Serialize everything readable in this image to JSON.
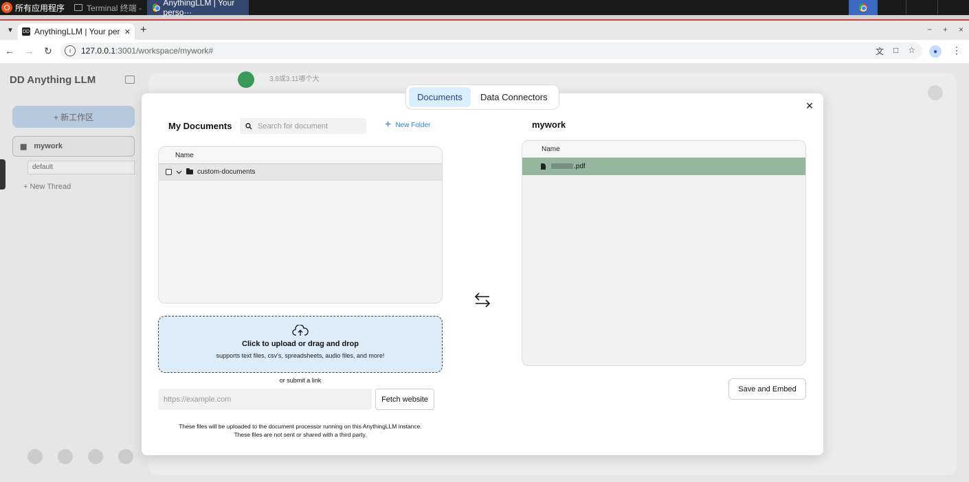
{
  "taskbar": {
    "start_label": "所有应用程序",
    "tasks": [
      {
        "label": "Terminal 终端 -"
      },
      {
        "label": "AnythingLLM | Your perso···"
      }
    ]
  },
  "browser": {
    "tab_title": "AnythingLLM | Your persona",
    "tab_favicon": "DD",
    "url_host": "127.0.0.1",
    "url_path": ":3001/workspace/mywork#",
    "window_controls": [
      "−",
      "+",
      "×"
    ]
  },
  "background": {
    "logo": "DD Anything LLM",
    "new_workspace": "+ 新工作区",
    "workspace_name": "mywork",
    "thread_default": "default",
    "new_thread": "+ New Thread",
    "chat_preview": "3.8或3.11哪个大"
  },
  "modal": {
    "tabs": [
      {
        "label": "Documents",
        "active": true
      },
      {
        "label": "Data Connectors",
        "active": false
      }
    ],
    "close_label": "×",
    "my_documents": {
      "title": "My Documents",
      "search_placeholder": "Search for document",
      "new_folder_label": "New Folder",
      "column_name": "Name",
      "folders": [
        {
          "name": "custom-documents"
        }
      ]
    },
    "upload": {
      "title": "Click to upload or drag and drop",
      "subtitle": "supports text files, csv's, spreadsheets, audio files, and more!",
      "or_link": "or submit a link",
      "link_placeholder": "https://example.com",
      "fetch_label": "Fetch website",
      "disclaimer_line1": "These files will be uploaded to the document processor running on this AnythingLLM instance.",
      "disclaimer_line2": "These files are not sent or shared with a third party."
    },
    "workspace": {
      "title": "mywork",
      "column_name": "Name",
      "files": [
        {
          "name_suffix": ".pdf"
        }
      ],
      "save_label": "Save and Embed"
    }
  }
}
